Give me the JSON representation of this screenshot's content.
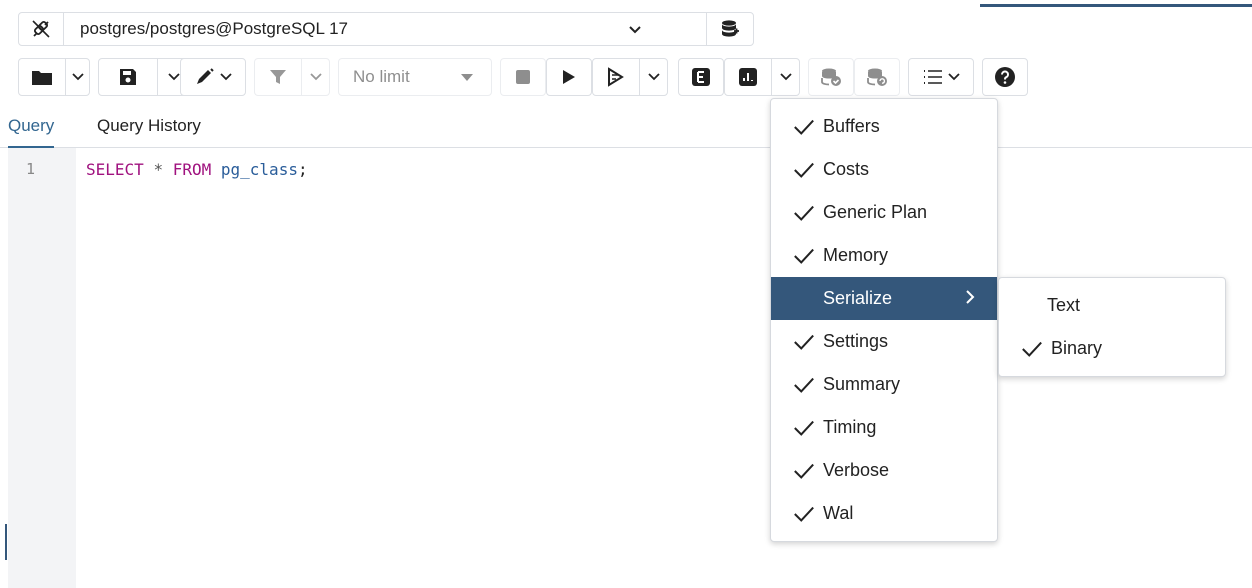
{
  "connection": {
    "label": "postgres/postgres@PostgreSQL 17"
  },
  "toolbar": {
    "limit_label": "No limit"
  },
  "tabs": [
    {
      "label": "Query",
      "active": true
    },
    {
      "label": "Query History",
      "active": false
    }
  ],
  "editor": {
    "line_number": "1",
    "code": {
      "kw_select": "SELECT",
      "star": "*",
      "kw_from": "FROM",
      "table": "pg_class",
      "semicolon": ";"
    }
  },
  "explain_menu": {
    "items": [
      {
        "label": "Buffers",
        "checked": true
      },
      {
        "label": "Costs",
        "checked": true
      },
      {
        "label": "Generic Plan",
        "checked": true
      },
      {
        "label": "Memory",
        "checked": true
      },
      {
        "label": "Serialize",
        "checked": false,
        "submenu": true
      },
      {
        "label": "Settings",
        "checked": true
      },
      {
        "label": "Summary",
        "checked": true
      },
      {
        "label": "Timing",
        "checked": true
      },
      {
        "label": "Verbose",
        "checked": true
      },
      {
        "label": "Wal",
        "checked": true
      }
    ],
    "serialize_submenu": [
      {
        "label": "Text",
        "checked": false
      },
      {
        "label": "Binary",
        "checked": true
      }
    ]
  },
  "colors": {
    "accent": "#34577b",
    "keyword": "#a0127f",
    "identifier": "#2a5d9a",
    "active_tab": "#326690"
  }
}
